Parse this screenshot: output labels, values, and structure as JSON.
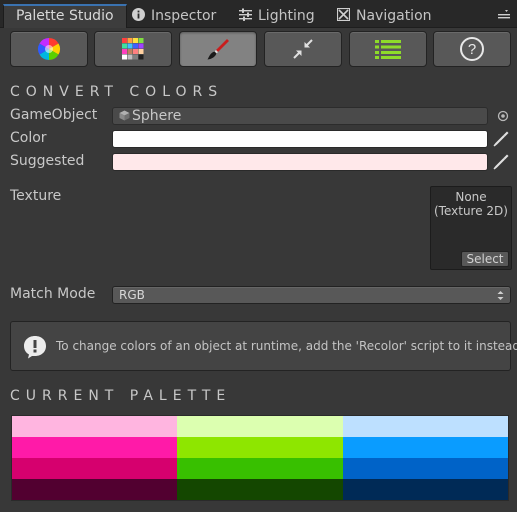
{
  "tabs": [
    {
      "label": "Palette Studio",
      "icon": "none",
      "active": true
    },
    {
      "label": "Inspector",
      "icon": "info-icon",
      "active": false
    },
    {
      "label": "Lighting",
      "icon": "sliders-icon",
      "active": false
    },
    {
      "label": "Navigation",
      "icon": "navigation-icon",
      "active": false
    }
  ],
  "toolbar": {
    "buttons": [
      {
        "icon": "color-wheel-icon",
        "active": false
      },
      {
        "icon": "color-grid-icon",
        "active": false
      },
      {
        "icon": "paintbrush-icon",
        "active": true
      },
      {
        "icon": "collapse-arrows-icon",
        "active": false
      },
      {
        "icon": "list-icon",
        "active": false
      },
      {
        "icon": "help-icon",
        "active": false
      }
    ],
    "help_glyph": "?"
  },
  "convert": {
    "title": "CONVERT COLORS",
    "gameobject_label": "GameObject",
    "gameobject_value": "Sphere",
    "color_label": "Color",
    "color_value": "#ffffff",
    "suggested_label": "Suggested",
    "suggested_value": "#ffe8ea",
    "texture_label": "Texture",
    "texture_value": "None (Texture 2D)",
    "texture_select": "Select",
    "match_mode_label": "Match Mode",
    "match_mode_value": "RGB"
  },
  "help": {
    "text": "To change colors of an object at runtime, add the 'Recolor' script to it instead."
  },
  "palette": {
    "title": "CURRENT PALETTE",
    "columns": [
      [
        "#ffb5e0",
        "#ff1aa8",
        "#d6006e",
        "#520030"
      ],
      [
        "#dcffb0",
        "#8ee600",
        "#38c000",
        "#144700"
      ],
      [
        "#bde0ff",
        "#0a9cff",
        "#0063c8",
        "#002a56"
      ]
    ]
  }
}
